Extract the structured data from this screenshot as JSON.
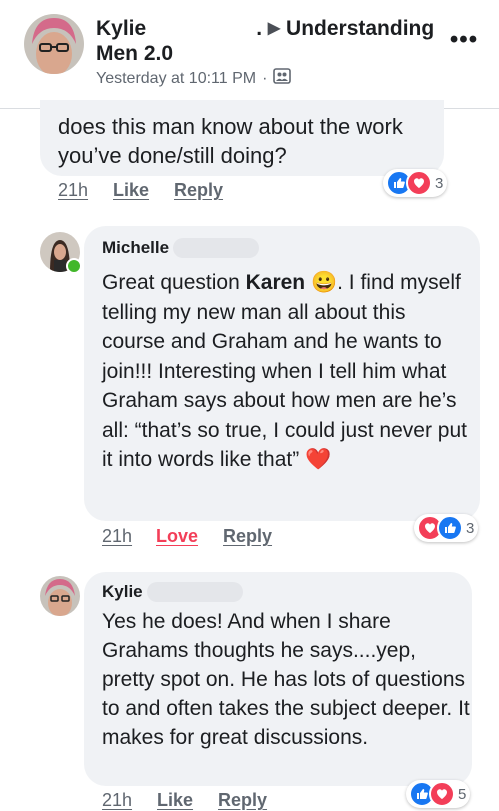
{
  "header": {
    "author": "Kylie",
    "arrow": "▶",
    "group": "Understanding",
    "group_cont": "Men 2.0",
    "timestamp": "Yesterday at 10:11 PM",
    "separator": "·",
    "more": "•••"
  },
  "comments": [
    {
      "text": "does this man know about the work you’ve done/still doing?",
      "time": "21h",
      "action": "Like",
      "reply": "Reply",
      "reaction_count": "3",
      "reaction_icons": [
        "like-icon",
        "love-icon"
      ]
    },
    {
      "name": "Michelle",
      "text_before": "Great question ",
      "mention": "Karen",
      "emoji": "😀",
      "text_after": ". I find myself telling my new man all about this course and Graham and he wants to join!!! Interesting when I tell him what Graham says about how men are he’s all: “that’s so true, I could just never put it into words like that”",
      "trailing_emoji": "❤️",
      "time": "21h",
      "action": "Love",
      "reply": "Reply",
      "reaction_count": "3",
      "reaction_icons": [
        "love-icon",
        "like-icon"
      ]
    },
    {
      "name": "Kylie",
      "text": "Yes he does! And when I share Grahams thoughts he says....yep, pretty spot on. He has lots of questions to and often takes the subject deeper. It makes for great discussions.",
      "time": "21h",
      "action": "Like",
      "reply": "Reply",
      "reaction_count": "5",
      "reaction_icons": [
        "like-icon",
        "love-icon"
      ]
    }
  ],
  "colors": {
    "like_blue": "#1877f2",
    "love_red": "#f33e58",
    "bubble_gray": "#f0f2f5",
    "online_green": "#42b72a"
  }
}
